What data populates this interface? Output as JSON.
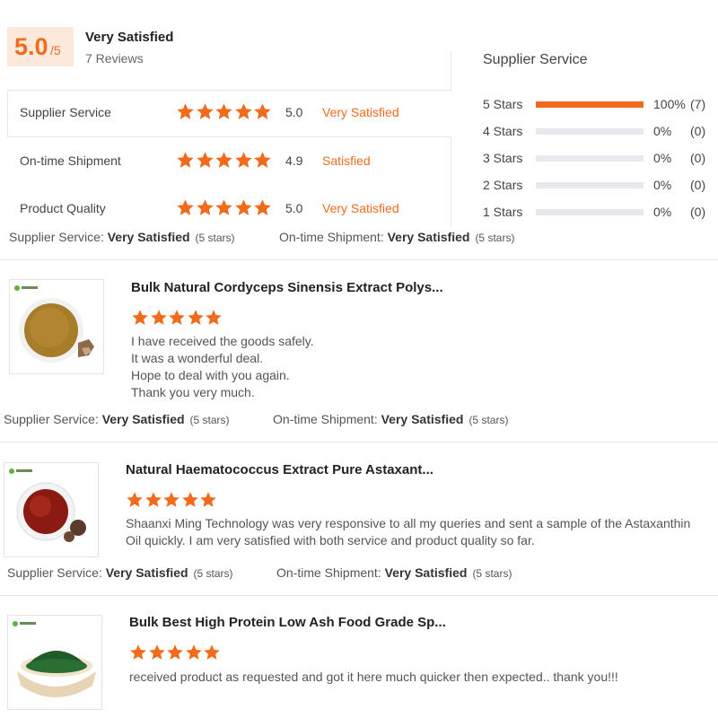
{
  "summary": {
    "score": "5.0",
    "score_out_of": "/5",
    "label": "Very Satisfied",
    "review_count": "7 Reviews"
  },
  "ratings": [
    {
      "label": "Supplier Service",
      "stars": 5,
      "score": "5.0",
      "text": "Very Satisfied"
    },
    {
      "label": "On-time Shipment",
      "stars": 5,
      "score": "4.9",
      "text": "Satisfied"
    },
    {
      "label": "Product Quality",
      "stars": 5,
      "score": "5.0",
      "text": "Very Satisfied"
    }
  ],
  "distribution": {
    "title": "Supplier Service",
    "rows": [
      {
        "label": "5 Stars",
        "fraction": 1.0,
        "percent": "100%",
        "count": "(7)"
      },
      {
        "label": "4 Stars",
        "fraction": 0,
        "percent": "0%",
        "count": "(0)"
      },
      {
        "label": "3 Stars",
        "fraction": 0,
        "percent": "0%",
        "count": "(0)"
      },
      {
        "label": "2 Stars",
        "fraction": 0,
        "percent": "0%",
        "count": "(0)"
      },
      {
        "label": "1 Stars",
        "fraction": 0,
        "percent": "0%",
        "count": "(0)"
      }
    ]
  },
  "summary_service": {
    "supplier_label": "Supplier Service:",
    "supplier_value": "Very Satisfied",
    "supplier_stars": "(5 stars)",
    "shipment_label": "On-time Shipment:",
    "shipment_value": "Very Satisfied",
    "shipment_stars": "(5 stars)"
  },
  "reviews": [
    {
      "title": "Bulk Natural Cordyceps Sinensis Extract Polys...",
      "stars": 5,
      "lines": [
        "I have received the goods safely.",
        "It was a wonderful deal.",
        "Hope to deal with you again.",
        "Thank you very much."
      ],
      "service": {
        "supplier_label": "Supplier Service:",
        "supplier_value": "Very Satisfied",
        "supplier_stars": "(5 stars)",
        "shipment_label": "On-time Shipment:",
        "shipment_value": "Very Satisfied",
        "shipment_stars": "(5 stars)"
      }
    },
    {
      "title": "Natural Haematococcus Extract Pure Astaxant...",
      "stars": 5,
      "lines": [
        "Shaanxi Ming Technology was very responsive to all my queries and sent a sample of the Astaxanthin",
        "Oil quickly. I am very satisfied with both service and product quality so far."
      ],
      "service": {
        "supplier_label": "Supplier Service:",
        "supplier_value": "Very Satisfied",
        "supplier_stars": "(5 stars)",
        "shipment_label": "On-time Shipment:",
        "shipment_value": "Very Satisfied",
        "shipment_stars": "(5 stars)"
      }
    },
    {
      "title": "Bulk Best High Protein Low Ash Food Grade Sp...",
      "stars": 5,
      "lines": [
        "received product as requested and got it here much quicker then expected.. thank you!!!"
      ]
    }
  ],
  "colors": {
    "accent": "#f26b1d",
    "accent_bg": "#fde8dc",
    "bar_bg": "#e8e8ed"
  },
  "icons": {
    "star": "star-icon"
  }
}
